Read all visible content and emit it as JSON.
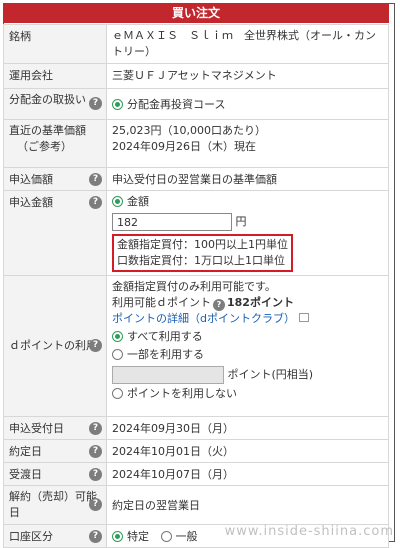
{
  "header": {
    "title": "買い注文"
  },
  "rows": {
    "fund": {
      "label": "銘柄",
      "value": "ｅＭＡＸＩＳ　Ｓｌｉｍ　全世界株式（オール・カントリー）"
    },
    "company": {
      "label": "運用会社",
      "value": "三菱ＵＦＪアセットマネジメント"
    },
    "distribution": {
      "label": "分配金の取扱い",
      "option": "分配金再投資コース"
    },
    "nav": {
      "label_line1": "直近の基準価額",
      "label_line2": "（ご参考）",
      "price": "25,023円（10,000口あたり）",
      "date": "2024年09月26日（木）現在"
    },
    "order_price": {
      "label": "申込価額",
      "value": "申込受付日の翌営業日の基準価額"
    },
    "amount": {
      "label": "申込金額",
      "mode": "金額",
      "input_value": "182",
      "unit": "円",
      "note_amount": "金額指定買付：100円以上1円単位",
      "note_units": "口数指定買付：1万口以上1口単位"
    },
    "dpoint": {
      "label": "ｄポイントの利用",
      "desc": "金額指定買付のみ利用可能です。",
      "available_label": "利用可能ｄポイント",
      "available_value": "182ポイント",
      "detail_link": "ポイントの詳細（dポイントクラブ）",
      "opt_all": "すべて利用する",
      "opt_part": "一部を利用する",
      "point_unit": "ポイント(円相当)",
      "opt_none": "ポイントを利用しない"
    },
    "accept_date": {
      "label": "申込受付日",
      "value": "2024年09月30日（月）"
    },
    "contract_date": {
      "label": "約定日",
      "value": "2024年10月01日（火）"
    },
    "delivery_date": {
      "label": "受渡日",
      "value": "2024年10月07日（月）"
    },
    "cancel": {
      "label": "解約（売却）可能日",
      "value": "約定日の翌営業日"
    },
    "account": {
      "label": "口座区分",
      "opt_specific": "特定",
      "opt_general": "一般"
    }
  },
  "watermark": "www.inside-shiina.com",
  "colors": {
    "header": "#c1272d",
    "radio_on": "#2e9c5a",
    "highlight_box": "#d21d28",
    "link": "#1a5fb4"
  },
  "icons": {
    "help": "question-circle-icon",
    "external": "external-link-icon"
  }
}
